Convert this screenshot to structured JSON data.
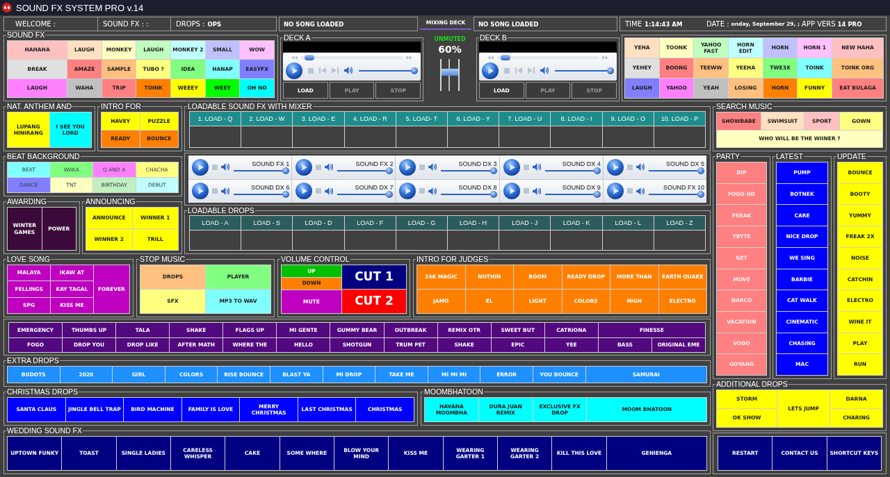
{
  "window": {
    "title": "SOUND FX SYSTEM PRO v.14"
  },
  "header": {
    "welcome": "WELCOME :",
    "sound_fx": "SOUND FX : :",
    "drops": {
      "label": "DROPS :",
      "value": "OPS"
    },
    "deck_a_song": "NO SONG LOADED",
    "mixing_tab": {
      "label": "MIXING DECK",
      "selected": true
    },
    "deck_b_song": "NO SONG LOADED",
    "time": {
      "label": "TIME",
      "value": "1:14:43 AM"
    },
    "date": {
      "label": "DATE :",
      "value": "onday, September 29, ;"
    },
    "app_version": {
      "label": "APP VERS",
      "value": "14 PRO"
    }
  },
  "sound_fx": {
    "title": "SOUND FX",
    "items": [
      {
        "label": "HAHAHA",
        "color": "#ffc0c0"
      },
      {
        "label": "LAUGH",
        "color": "#ffe0c0"
      },
      {
        "label": "MONKEY",
        "color": "#ffffc0"
      },
      {
        "label": "LAUGH",
        "color": "#c0ffc0"
      },
      {
        "label": "MONKEY 2",
        "color": "#c0ffff"
      },
      {
        "label": "SMALL",
        "color": "#c0c0ff"
      },
      {
        "label": "WOW",
        "color": "#ffc0ff"
      },
      {
        "label": "BREAK",
        "color": "#e0e0e0"
      },
      {
        "label": "AMAZE",
        "color": "#ff8080"
      },
      {
        "label": "SAMPLE",
        "color": "#ffc080"
      },
      {
        "label": "TUBO ?",
        "color": "#ffff80"
      },
      {
        "label": "IDEA",
        "color": "#80ff80"
      },
      {
        "label": "HANAP",
        "color": "#80ffff"
      },
      {
        "label": "EASYFX",
        "color": "#8080ff"
      },
      {
        "label": "LAUGH",
        "color": "#ff80ff"
      },
      {
        "label": "WAHA",
        "color": "#c0c0c0"
      },
      {
        "label": "TRIP",
        "color": "#ff8080"
      },
      {
        "label": "TOINK",
        "color": "#ff8000"
      },
      {
        "label": "WEEEY",
        "color": "#ffff00"
      },
      {
        "label": "WEEY",
        "color": "#00ff00"
      },
      {
        "label": "OH NO",
        "color": "#00ffff"
      }
    ]
  },
  "deck_a": {
    "title": "DECK A",
    "seek": {
      "level": 0.04
    },
    "volume": {
      "level": 1
    },
    "buttons": [
      {
        "label": "LOAD",
        "disabled": false
      },
      {
        "label": "PLAY",
        "disabled": true
      },
      {
        "label": "STOP",
        "disabled": true
      }
    ]
  },
  "mixer": {
    "status": "UNMUTED",
    "reading": "60%",
    "level": 0.6
  },
  "deck_b": {
    "title": "DECK B",
    "seek": {
      "level": 0.04
    },
    "volume": {
      "level": 1
    },
    "buttons": [
      {
        "label": "LOAD",
        "disabled": false
      },
      {
        "label": "PLAY",
        "disabled": true
      },
      {
        "label": "STOP",
        "disabled": true
      }
    ]
  },
  "sound_fx_more": {
    "items": [
      {
        "label": "YEHA",
        "color": "#ffe0c0"
      },
      {
        "label": "TOONK",
        "color": "#ffffc0"
      },
      {
        "label": "YAHOO FAST",
        "color": "#c0ffc0"
      },
      {
        "label": "HORN EDIT",
        "color": "#c0ffff"
      },
      {
        "label": "HORN",
        "color": "#c0c0ff"
      },
      {
        "label": "HORN 1",
        "color": "#ffc0ff"
      },
      {
        "label": "NEW HAHA",
        "color": "#ffc0c0"
      },
      {
        "label": "YEHEY",
        "color": "#e0e0e0"
      },
      {
        "label": "BOONG",
        "color": "#ff8080"
      },
      {
        "label": "TEEWW",
        "color": "#ffc080"
      },
      {
        "label": "YEEHA",
        "color": "#ffff80"
      },
      {
        "label": "TWE3X",
        "color": "#80ff80"
      },
      {
        "label": "TOINK",
        "color": "#80ffff"
      },
      {
        "label": "TOINK ORG",
        "color": "#ffc080"
      },
      {
        "label": "LAUGH",
        "color": "#8080ff"
      },
      {
        "label": "YAHOO",
        "color": "#ff80ff"
      },
      {
        "label": "YEAH",
        "color": "#c0c0c0"
      },
      {
        "label": "LOSING",
        "color": "#ffc080"
      },
      {
        "label": "HORN",
        "color": "#ff8000"
      },
      {
        "label": "FUNNY",
        "color": "#ffff00"
      },
      {
        "label": "EAT BULAGA",
        "color": "#ff8080"
      }
    ]
  },
  "nat_anthem": {
    "title": "NAT. ANTHEM AND",
    "items": [
      {
        "label": "LUPANG HINIRANG",
        "color": "#ffff00"
      },
      {
        "label": "I SEE YOU LORD",
        "color": "#00ffff"
      }
    ]
  },
  "intro_for": {
    "title": "INTRO FOR",
    "items": [
      {
        "label": "HAVEY",
        "color": "#ffff00"
      },
      {
        "label": "PUZZLE",
        "color": "#ffff00"
      },
      {
        "label": "READY",
        "color": "#ff8000"
      },
      {
        "label": "BOUNCE",
        "color": "#ff8000"
      }
    ]
  },
  "beat_background": {
    "title": "BEAT BACKGROUND",
    "items": [
      {
        "label": "BEAT",
        "color": "#80ffff",
        "disabled": true
      },
      {
        "label": "WAKA",
        "color": "#80ff80",
        "disabled": true
      },
      {
        "label": "Q AND A",
        "color": "#ff80ff",
        "disabled": true
      },
      {
        "label": "CHACHA",
        "color": "#ffff80",
        "disabled": true
      },
      {
        "label": "DANCE",
        "color": "#8080ff",
        "disabled": true
      },
      {
        "label": "TNT",
        "color": "#ffffc0",
        "disabled": true
      },
      {
        "label": "BIRTHDAY",
        "color": "#c0f0c0",
        "disabled": true
      },
      {
        "label": "DEBUT",
        "color": "#c0ffff",
        "disabled": true
      }
    ]
  },
  "awarding": {
    "title": "AWARDING",
    "items": [
      "WINTER GAMES",
      "POWER"
    ]
  },
  "announcing": {
    "title": "ANNOUNCING",
    "items": [
      "ANNOUNCE",
      "WINNER 1",
      "WINNER 2",
      "TRILL"
    ]
  },
  "loadable_sound_fx": {
    "title": "LOADABLE SOUND FX WITH MIXER",
    "columns": [
      "1. LOAD - Q",
      "2. LOAD - W",
      "3. LOAD - E",
      "4. LOAD - R",
      "5. LOAD- T",
      "6. LOAD - Y",
      "7. LOAD - U",
      "8. LOAD - I",
      "9. LOAD - O",
      "10. LOAD - P"
    ]
  },
  "mixer_players": [
    {
      "label": "SOUND FX 1",
      "volume": {
        "level": 1
      }
    },
    {
      "label": "SOUND FX 2",
      "volume": {
        "level": 1
      }
    },
    {
      "label": "SOUND DX 3",
      "volume": {
        "level": 1
      }
    },
    {
      "label": "SOUND DX 4",
      "volume": {
        "level": 1
      }
    },
    {
      "label": "SOUND DX 5",
      "volume": {
        "level": 1
      }
    },
    {
      "label": "SOUND DX 6",
      "volume": {
        "level": 1
      }
    },
    {
      "label": "SOUND DX 7",
      "volume": {
        "level": 1
      }
    },
    {
      "label": "SOUND DX 8",
      "volume": {
        "level": 1
      }
    },
    {
      "label": "SOUND DX 9",
      "volume": {
        "level": 1
      }
    },
    {
      "label": "SOUND FX 10",
      "volume": {
        "level": 1
      }
    }
  ],
  "loadable_drops": {
    "title": "LOADABLE DROPS",
    "columns": [
      "LOAD - A",
      "LOAD - S",
      "LOAD - D",
      "LOAD - F",
      "LOAD - G",
      "LOAD - H",
      "LOAD - J",
      "LOAD - K",
      "LOAD - L",
      "LOAD - Z"
    ]
  },
  "love_song": {
    "title": "LOVE SONG",
    "items": [
      {
        "label": "MALAYA",
        "kind": "normal"
      },
      {
        "label": "IKAW AT",
        "kind": "normal"
      },
      {
        "label": "FELLINGS",
        "kind": "normal"
      },
      {
        "label": "KAY TAGAL",
        "kind": "normal"
      },
      {
        "label": "FOREVER",
        "kind": "tall"
      },
      {
        "label": "SPG",
        "kind": "normal"
      },
      {
        "label": "KISS ME",
        "kind": "normal"
      }
    ]
  },
  "stop_music": {
    "title": "STOP MUSIC",
    "items": [
      {
        "label": "DROPS",
        "color": "#ffc080"
      },
      {
        "label": "PLAYER",
        "color": "#80ff80"
      },
      {
        "label": "SFX",
        "color": "#ffff80"
      },
      {
        "label": "MP3 TO WAV",
        "color": "#80ffff"
      }
    ]
  },
  "volume_control": {
    "title": "VOLUME CONTROL",
    "left": [
      {
        "label": "UP",
        "color": "#00c000"
      },
      {
        "label": "DOWN",
        "color": "#ff8000"
      },
      {
        "label": "MUTE",
        "color": "#c000c0"
      }
    ],
    "right": [
      {
        "label": "CUT 1",
        "color": "#000080"
      },
      {
        "label": "CUT 2",
        "color": "#ff0000"
      }
    ]
  },
  "intro_for_judges": {
    "title": "INTRO FOR JUDGES",
    "items": [
      "24K MAGIC",
      "NOTHIN",
      "BOOM",
      "READY DROP",
      "MORE THAN",
      "EARTH QUAKE",
      "JAMO",
      "EL",
      "LIGHT",
      "COLORS",
      "HIGH",
      "ELECTRO"
    ]
  },
  "drops_panel": {
    "items": [
      {
        "label": "EMERGENCY",
        "kind": "normal"
      },
      {
        "label": "THUMBS UP",
        "kind": "normal"
      },
      {
        "label": "TALA",
        "kind": "normal"
      },
      {
        "label": "SHAKE",
        "kind": "normal"
      },
      {
        "label": "FLAGS UP",
        "kind": "normal"
      },
      {
        "label": "MI GENTE",
        "kind": "normal"
      },
      {
        "label": "GUMMY BEAR",
        "kind": "normal"
      },
      {
        "label": "OUTBREAK",
        "kind": "normal"
      },
      {
        "label": "REMIX OTR",
        "kind": "normal"
      },
      {
        "label": "SWEET BUT",
        "kind": "normal"
      },
      {
        "label": "CATRIONA",
        "kind": "normal"
      },
      {
        "label": "FINESSE",
        "kind": "wide"
      },
      {
        "label": "FOGO",
        "kind": "normal"
      },
      {
        "label": "DROP YOU",
        "kind": "normal"
      },
      {
        "label": "DROP LIKE",
        "kind": "normal"
      },
      {
        "label": "AFTER MATH",
        "kind": "normal"
      },
      {
        "label": "WHERE THE",
        "kind": "normal"
      },
      {
        "label": "HELLO",
        "kind": "normal"
      },
      {
        "label": "SHOTGUN",
        "kind": "normal"
      },
      {
        "label": "TRUM PET",
        "kind": "normal"
      },
      {
        "label": "SHAKE",
        "kind": "normal"
      },
      {
        "label": "EPIC",
        "kind": "normal"
      },
      {
        "label": "YEE",
        "kind": "normal"
      },
      {
        "label": "BASS",
        "kind": "normal"
      },
      {
        "label": "ORIGINAL EME",
        "kind": "normal"
      }
    ]
  },
  "extra_drops": {
    "title": "EXTRA DROPS",
    "items": [
      {
        "label": "BUDOTS",
        "kind": "normal"
      },
      {
        "label": "2020",
        "kind": "normal"
      },
      {
        "label": "GIRL",
        "kind": "normal"
      },
      {
        "label": "COLORS",
        "kind": "normal"
      },
      {
        "label": "RISE BOUNCE",
        "kind": "normal"
      },
      {
        "label": "BLAST YA",
        "kind": "normal"
      },
      {
        "label": "MI DROP",
        "kind": "normal"
      },
      {
        "label": "TAKE ME",
        "kind": "normal"
      },
      {
        "label": "MI MI MI",
        "kind": "normal"
      },
      {
        "label": "ERROR",
        "kind": "normal"
      },
      {
        "label": "YOU BOUNCE",
        "kind": "normal"
      },
      {
        "label": "SAMURAI",
        "kind": "wide"
      }
    ]
  },
  "christmas_drops": {
    "title": "CHRISTMAS DROPS",
    "items": [
      "SANTA CLAUS",
      "JINGLE BELL TRAP",
      "BIRD MACHINE",
      "FAMILY IS LOVE",
      "MERRY CHRISTMAS",
      "LAST CHRISTMAS",
      "CHRISTMAS"
    ]
  },
  "moombhatoon": {
    "title": "MOOMBHATOON",
    "items": [
      {
        "label": "HAVANA MOOMBHA",
        "kind": "normal"
      },
      {
        "label": "DURA JUAN REMIX",
        "kind": "normal"
      },
      {
        "label": "EXCLUSIVE FX DROP",
        "kind": "normal"
      },
      {
        "label": "MOOM BHATOON",
        "kind": "wide"
      }
    ]
  },
  "wedding_sound_fx": {
    "title": "WEDDING SOUND FX",
    "items": [
      {
        "label": "UPTOWN FUNKY",
        "kind": "normal"
      },
      {
        "label": "TOAST",
        "kind": "normal"
      },
      {
        "label": "SINGLE LADIES",
        "kind": "normal"
      },
      {
        "label": "CARELESS WHISPER",
        "kind": "normal"
      },
      {
        "label": "CAKE",
        "kind": "normal"
      },
      {
        "label": "SOME WHERE",
        "kind": "normal"
      },
      {
        "label": "BLOW YOUR MIND",
        "kind": "normal"
      },
      {
        "label": "KISS ME",
        "kind": "normal"
      },
      {
        "label": "WEARING GARTER 1",
        "kind": "normal"
      },
      {
        "label": "WEARING GARTER 2",
        "kind": "normal"
      },
      {
        "label": "KILL THIS LOVE",
        "kind": "normal"
      },
      {
        "label": "GENIENGA",
        "kind": "wide"
      }
    ]
  },
  "search_music": {
    "title": "SEARCH MUSIC",
    "items": [
      {
        "label": "SHOWBABE",
        "color": "#ff8080",
        "kind": "normal"
      },
      {
        "label": "SWIMSUIT",
        "color": "#ffe0c0",
        "kind": "normal"
      },
      {
        "label": "SPORT",
        "color": "#ffc0c0",
        "kind": "normal"
      },
      {
        "label": "GOWN",
        "color": "#ffff80",
        "kind": "normal"
      },
      {
        "label": "WHO WILL BE THE WIINER ?",
        "color": "#ffffc0",
        "kind": "wide"
      }
    ]
  },
  "party": {
    "title": "PARTY",
    "items": [
      "DIP",
      "FOGO HD",
      "FREAK",
      "YBYTE",
      "GET",
      "MOVE",
      "NARCO",
      "VACATION",
      "VODO",
      "GOYANG"
    ]
  },
  "latest": {
    "title": "LATEST",
    "items": [
      "PUMP",
      "BOTNEK",
      "CARE",
      "NICE DROP",
      "WE SING",
      "BARBIE",
      "CAT WALK",
      "CINEMATIC",
      "CHASING",
      "MAC"
    ]
  },
  "update": {
    "title": "UPDATE",
    "items": [
      "BOUNCE",
      "BOOTY",
      "YUMMY",
      "FREAK 2X",
      "NOISE",
      "CATCHIN",
      "ELECTRO",
      "WINE IT",
      "PLAY",
      "RUN"
    ]
  },
  "additional_drops": {
    "title": "ADDITIONAL DROPS",
    "items": [
      {
        "label": "STORM",
        "kind": "normal"
      },
      {
        "label": "LETS JUMP",
        "kind": "tall"
      },
      {
        "label": "DARNA",
        "kind": "normal"
      },
      {
        "label": "OK SHOW",
        "kind": "normal"
      },
      {
        "label": "CHARING",
        "kind": "normal"
      }
    ]
  },
  "system_buttons": [
    "RESTART",
    "CONTACT US",
    "SHORTCUT KEYS"
  ]
}
